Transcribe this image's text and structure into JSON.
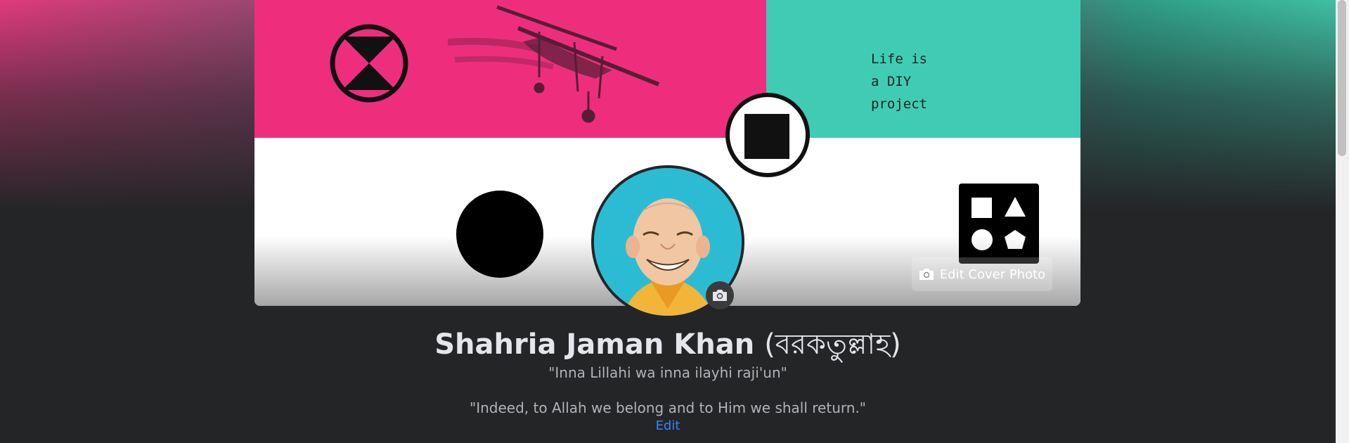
{
  "cover": {
    "quote": "Life is\na DIY\nproject",
    "edit_label": "Edit Cover Photo",
    "colors": {
      "pink": "#ee2e7c",
      "teal": "#40ccb4",
      "white": "#ffffff"
    }
  },
  "profile": {
    "name": "Shahria Jaman Khan",
    "alt_name": "(বরকতুল্লাহ)",
    "bio_line1": "\"Inna Lillahi wa inna ilayhi raji'un\"",
    "bio_line2": "\"Indeed, to Allah we belong and to Him we shall return.\"",
    "edit_label": "Edit"
  },
  "icons": [
    "camera-icon",
    "avatar-camera-icon",
    "hourglass-icon",
    "biplane-icon",
    "square-in-circle-icon",
    "circle-icon",
    "shapes-icon"
  ],
  "colors": {
    "background": "#242527",
    "accent": "#2d88ff",
    "text_primary": "#e4e6eb",
    "text_secondary": "#b0b3b8"
  }
}
